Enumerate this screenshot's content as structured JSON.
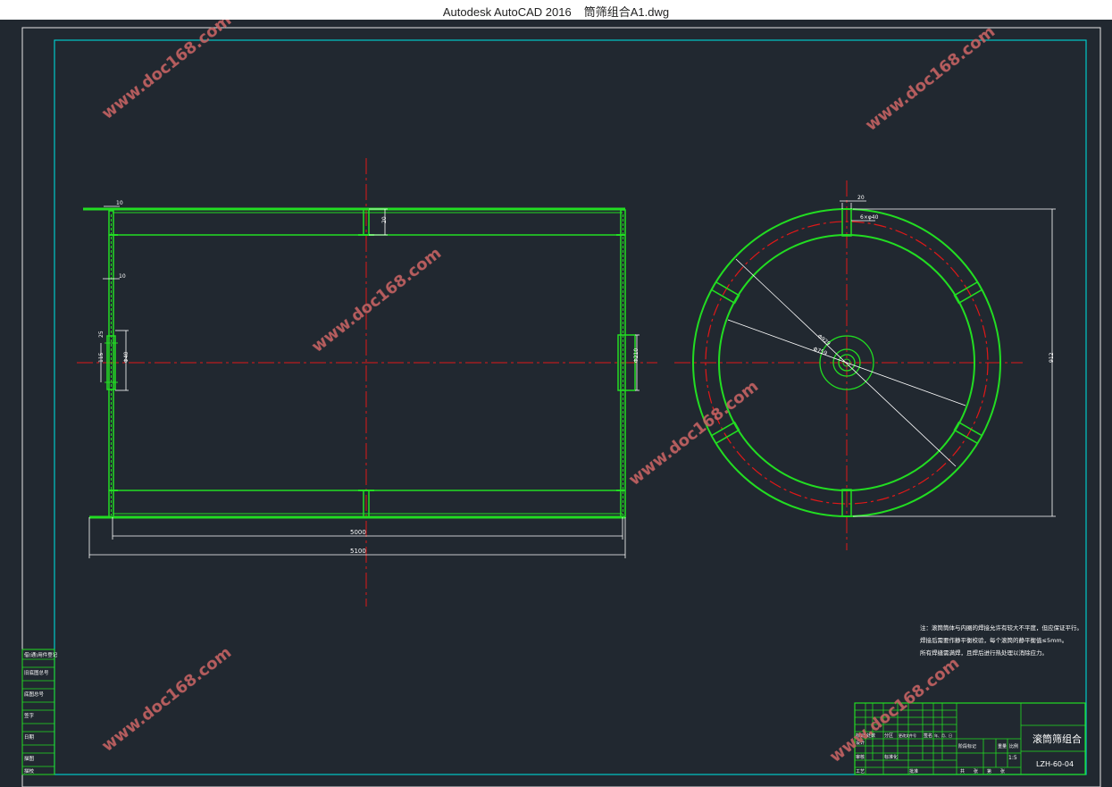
{
  "window": {
    "app_title": "Autodesk AutoCAD 2016",
    "file_name": "筒筛组合A1.dwg"
  },
  "drawing": {
    "colors": {
      "background": "#212830",
      "border": "#e6e6e6",
      "frame": "#00c8c8",
      "part": "#22dd22",
      "centerline": "#e01818",
      "dimension": "#ffffff",
      "watermark": "#c86464"
    },
    "watermark_text": "www.doc168.com",
    "dims": {
      "overall_length": "5100",
      "inner_length": "5000",
      "tiny_top": "10",
      "top_thk": "20",
      "left_10": "10",
      "left_25": "25",
      "left_115": "115",
      "left_phi": "Φ40",
      "right_phi": "Φ210",
      "end_w": "20",
      "end_label": "6×φ40",
      "dia_big": "Φ929",
      "dia_small": "Φ759",
      "side_height": "912"
    },
    "notes": {
      "line1": "注：滚筒筒体与内圈的焊接允许有较大不平度，但应保证平行。",
      "line2": "     焊接后需要作静平衡校验，每个滚筒的静平衡值≤5mm。",
      "line3": "     所有焊缝需满焊，且焊后进行热处理以消除应力。"
    },
    "title_block": {
      "name": "滚筒筛组合",
      "code": "LZH-60-04",
      "scale": "1:5",
      "cells": [
        "标记",
        "处数",
        "分区",
        "更改文件号",
        "签名",
        "年、月、日",
        "设计",
        "审核",
        "工艺",
        "标准化",
        "批准",
        "阶段标记",
        "重量",
        "比例",
        "共",
        "张",
        "第",
        "张"
      ]
    },
    "side_table": {
      "rows": [
        "借(通)用件登记",
        "旧底图总号",
        "底图总号",
        "签字",
        "日期",
        "描图",
        "描校"
      ]
    }
  }
}
